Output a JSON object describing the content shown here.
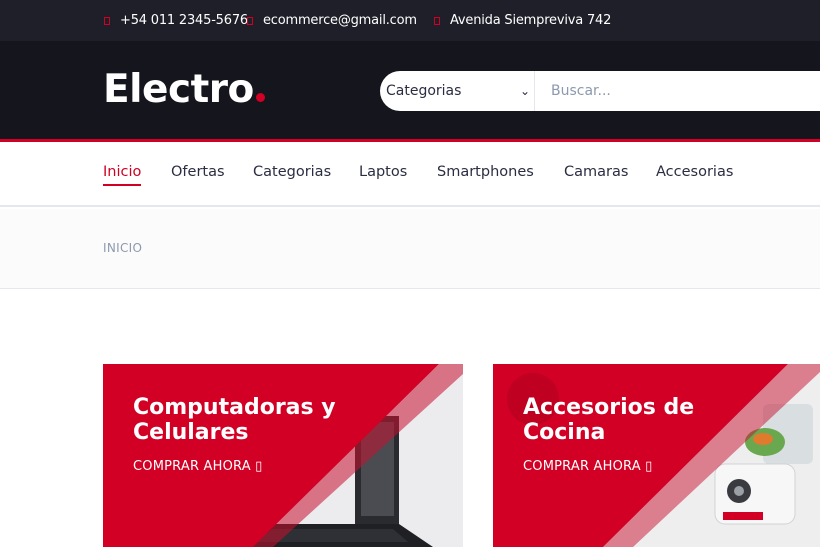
{
  "topbar": {
    "phone": "+54 011 2345-5676",
    "email": "ecommerce@gmail.com",
    "address": "Avenida Siempreviva 742"
  },
  "header": {
    "logo_text": "Electro",
    "category_select": "Categorias",
    "search_placeholder": "Buscar..."
  },
  "nav": {
    "items": [
      {
        "label": "Inicio"
      },
      {
        "label": "Ofertas"
      },
      {
        "label": "Categorias"
      },
      {
        "label": "Laptos"
      },
      {
        "label": "Smartphones"
      },
      {
        "label": "Camaras"
      },
      {
        "label": "Accesorias"
      }
    ]
  },
  "breadcrumb": {
    "current": "INICIO"
  },
  "cards": [
    {
      "title_line1": "Computadoras y",
      "title_line2": "Celulares",
      "cta": "COMPRAR AHORA ▯"
    },
    {
      "title_line1": "Accesorios de",
      "title_line2": "Cocina",
      "cta": "COMPRAR AHORA ▯"
    }
  ],
  "colors": {
    "accent": "#d10024",
    "dark": "#15161d",
    "topbar": "#1e1f29"
  }
}
